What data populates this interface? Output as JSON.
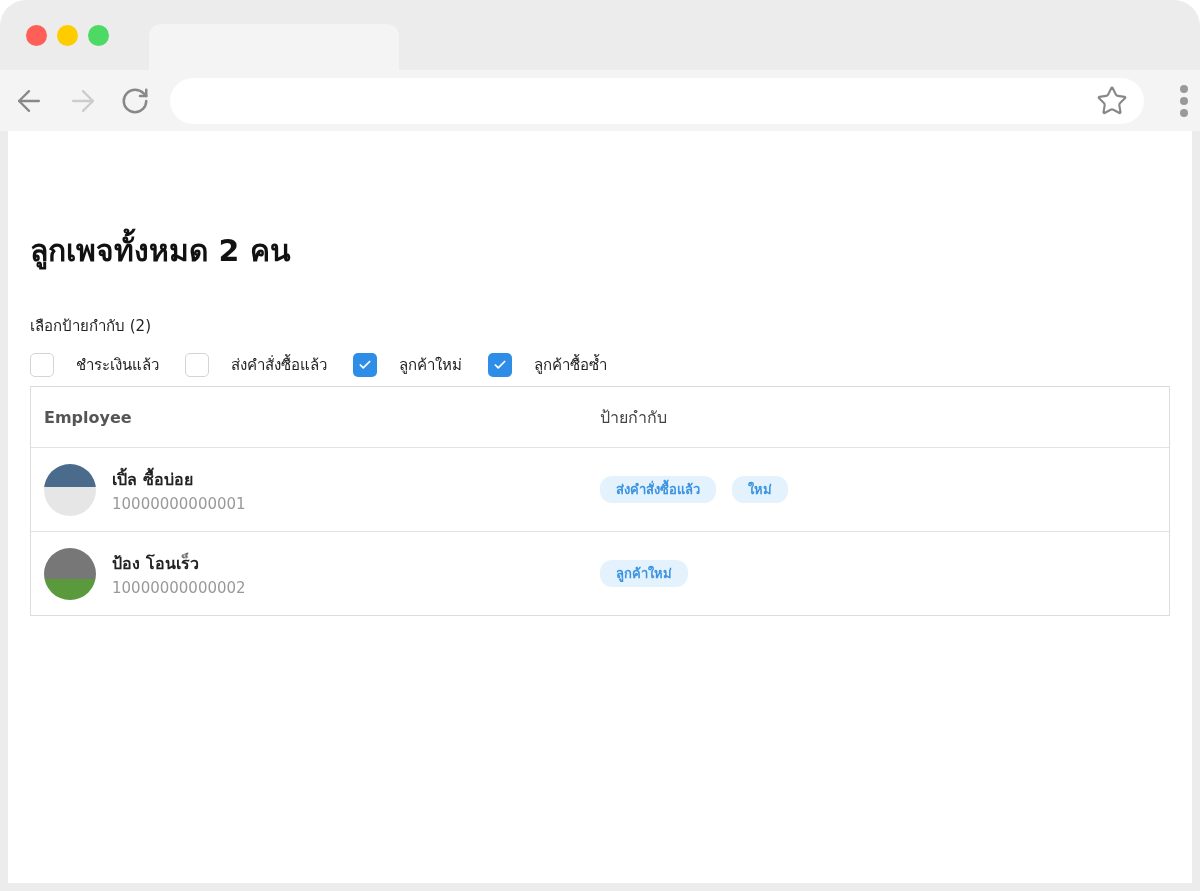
{
  "page": {
    "title": "ลูกเพจทั้งหมด 2 คน"
  },
  "filter": {
    "label": "เลือกป้ายกำกับ (2)",
    "options": [
      {
        "label": "ชำระเงินแล้ว",
        "checked": false
      },
      {
        "label": "ส่งคำสั่งซื้อแล้ว",
        "checked": false
      },
      {
        "label": "ลูกค้าใหม่",
        "checked": true
      },
      {
        "label": "ลูกค้าซื้อซ้ำ",
        "checked": true
      }
    ]
  },
  "table": {
    "columns": [
      "Employee",
      "ป้ายกำกับ"
    ],
    "rows": [
      {
        "name": "เปิ้ล ซื้อบ่อย",
        "id": "10000000000001",
        "tags": [
          "ส่งคำสั่งซื้อแล้ว",
          "ใหม่"
        ]
      },
      {
        "name": "ป้อง โอนเร็ว",
        "id": "10000000000002",
        "tags": [
          "ลูกค้าใหม่"
        ]
      }
    ]
  }
}
